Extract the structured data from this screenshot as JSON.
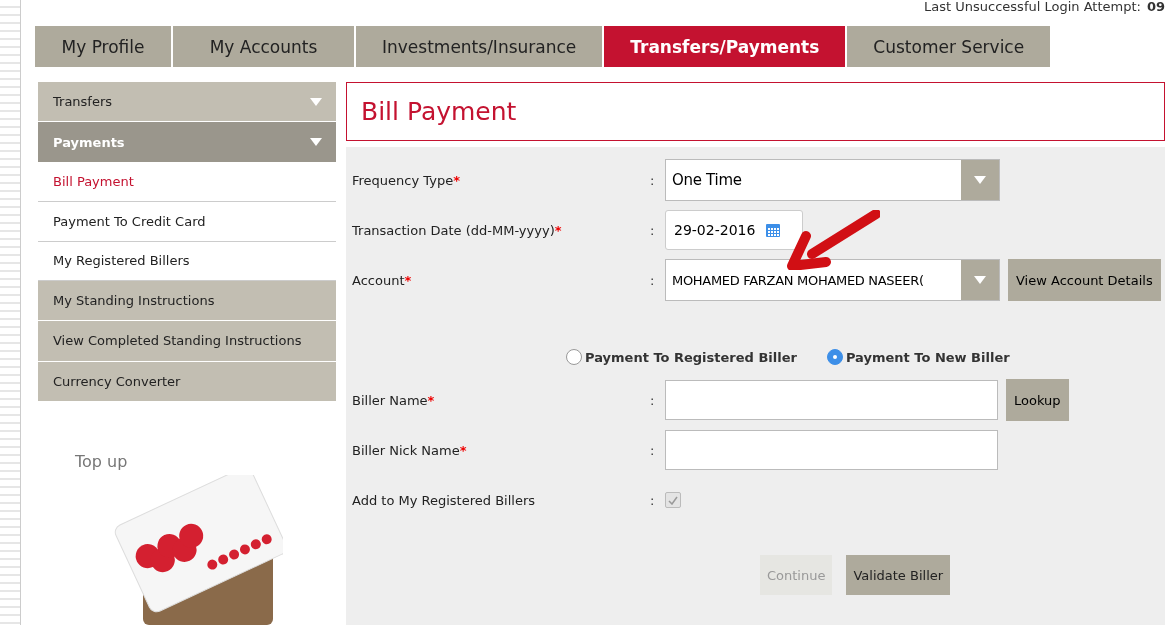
{
  "login_notice": {
    "label": "Last Unsuccessful Login Attempt:",
    "value": "09"
  },
  "tabs": [
    {
      "label": "My Profile",
      "selected": false
    },
    {
      "label": "My Accounts",
      "selected": false
    },
    {
      "label": "Investments/Insurance",
      "selected": false
    },
    {
      "label": "Transfers/Payments",
      "selected": true
    },
    {
      "label": "Customer Service",
      "selected": false
    }
  ],
  "sidebar": {
    "items": [
      {
        "kind": "section",
        "label": "Transfers",
        "expanded": false
      },
      {
        "kind": "section",
        "label": "Payments",
        "expanded": true,
        "children": [
          {
            "label": "Bill Payment",
            "selected": true
          },
          {
            "label": "Payment To Credit Card",
            "selected": false
          },
          {
            "label": "My Registered Billers",
            "selected": false
          }
        ]
      },
      {
        "kind": "section",
        "label": "My Standing Instructions",
        "expanded": false
      },
      {
        "kind": "section",
        "label": "View Completed Standing Instructions",
        "expanded": false
      },
      {
        "kind": "section",
        "label": "Currency Converter",
        "expanded": false
      }
    ]
  },
  "promo": {
    "title": "Top up"
  },
  "page_title": "Bill Payment",
  "form": {
    "required_mark": "*",
    "separator": ":",
    "fields": [
      {
        "kind": "select",
        "label": "Frequency Type",
        "required": true,
        "value": "One Time"
      },
      {
        "kind": "date",
        "label": "Transaction Date (dd-MM-yyyy)",
        "required": true,
        "value": "29-02-2016"
      },
      {
        "kind": "select",
        "label": "Account",
        "required": true,
        "value": "MOHAMED FARZAN MOHAMED NASEER(",
        "button": "View Account Details"
      }
    ],
    "radios": [
      {
        "label": "Payment To Registered Biller",
        "selected": false
      },
      {
        "label": "Payment To New Biller",
        "selected": true
      }
    ],
    "biller_fields": [
      {
        "kind": "text",
        "label": "Biller Name",
        "required": true,
        "button": "Lookup"
      },
      {
        "kind": "text",
        "label": "Biller Nick Name",
        "required": true
      },
      {
        "kind": "checkbox",
        "label": "Add to My Registered Billers",
        "required": false,
        "checked": true,
        "disabled": true
      }
    ],
    "buttons": [
      {
        "label": "Continue",
        "disabled": true
      },
      {
        "label": "Validate Biller",
        "disabled": false
      }
    ]
  }
}
